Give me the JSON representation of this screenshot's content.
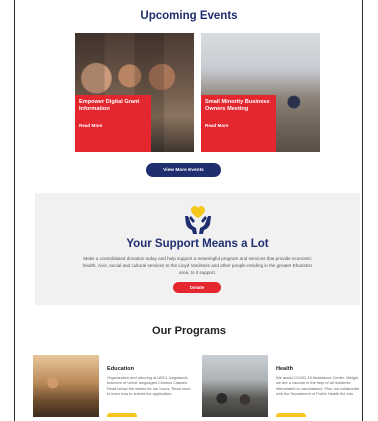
{
  "events": {
    "heading": "Upcoming Events",
    "cards": [
      {
        "name": "Empower Digital Grant Information",
        "link": "Read More"
      },
      {
        "name": "Small Minority Business Owners Meeting",
        "link": "Read More"
      }
    ],
    "view_more_label": "View More Events"
  },
  "support": {
    "heading": "Your Support Means a Lot",
    "body": "Make a consolidated donation today and help support a meaningful program and services that provide economic health, civic, social and cultural services to the Lloyd Vanilsses and other people residing in the greater Ehariston area, to it support.",
    "donate_label": "Donate",
    "icon": "heart-hands-icon",
    "colors": {
      "heart": "#f5c61b",
      "hands": "#1f2e6f"
    }
  },
  "programs": {
    "heading": "Our Programs",
    "items": [
      {
        "title": "Education",
        "desc": "Organization and reboring at UBCL longstands teachers of Untuir languaged Chiness Classes. Read below the weeks for our hours. Read more to learn how to submit the application."
      },
      {
        "title": "Health",
        "desc": "We assist COVID-19 Assistance Center. Weight we are a vaccine in the help of all residents interrelated to vaccinations. Plus, we collaborate with the Department of Public Health the info."
      }
    ]
  },
  "colors": {
    "brand_navy": "#1f2e6f",
    "accent_red": "#e4262e",
    "accent_yellow": "#f5c61b"
  }
}
